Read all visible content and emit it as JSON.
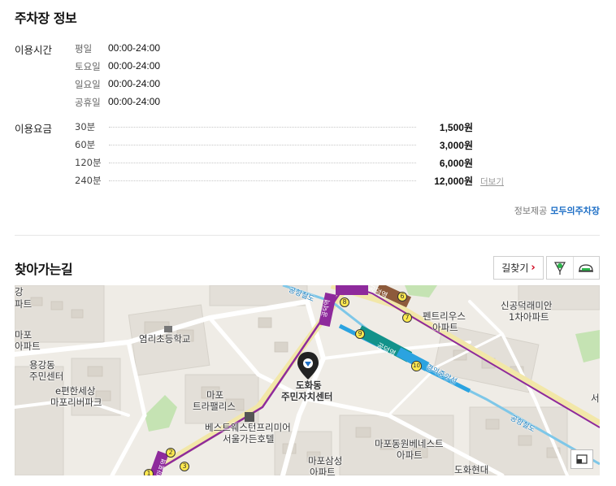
{
  "info": {
    "title": "주차장 정보",
    "hours_label": "이용시간",
    "hours": [
      {
        "day": "평일",
        "time": "00:00-24:00"
      },
      {
        "day": "토요일",
        "time": "00:00-24:00"
      },
      {
        "day": "일요일",
        "time": "00:00-24:00"
      },
      {
        "day": "공휴일",
        "time": "00:00-24:00"
      }
    ],
    "fee_label": "이용요금",
    "fees": [
      {
        "duration": "30분",
        "price": "1,500원"
      },
      {
        "duration": "60분",
        "price": "3,000원"
      },
      {
        "duration": "120분",
        "price": "6,000원"
      },
      {
        "duration": "240분",
        "price": "12,000원"
      }
    ],
    "more_label": "더보기",
    "provider_label": "정보제공",
    "provider_name": "모두의주차장"
  },
  "directions": {
    "title": "찾아가는길",
    "route_button": "길찾기",
    "route_chevron": "›"
  },
  "map": {
    "labels": {
      "gang": "강",
      "apt_left": "파트",
      "mapo_apt_1": "마포",
      "mapo_apt_2": "아파트",
      "yeomni_school": "염리초등학교",
      "yonggang_1": "용강동",
      "yonggang_2": "주민센터",
      "epyeonhan_1": "e편한세상",
      "epyeonhan_2": "마포리버파크",
      "trapalace_1": "마포",
      "trapalace_2": "트라팰리스",
      "best_western_1": "베스트웨스턴프리미어",
      "best_western_2": "서울가든호텔",
      "target_1": "도화동",
      "target_2": "주민자치센터",
      "pentarius_1": "펜트리우스",
      "pentarius_2": "아파트",
      "singong_1": "신공덕래미안",
      "singong_2": "1차아파트",
      "mapo_benest_1": "마포동원베네스트",
      "mapo_benest_2": "아파트",
      "mapo_samsung_1": "마포삼성",
      "mapo_samsung_2": "아파트",
      "dohwa_hyundai": "도화현대",
      "seo": "서",
      "gongdeok_station_top": "공덕역",
      "gongdeok_station_mid": "공덕역",
      "gyeongui_line": "경의중앙선",
      "airport_rail_top": "공항철도",
      "airport_rail_right": "공항철도",
      "gongdeok_vertical": "공덕역",
      "mapo_station": "마포역",
      "exit_1": "1",
      "exit_2": "2",
      "exit_3": "3",
      "exit_6": "6",
      "exit_7": "7",
      "exit_8": "8",
      "exit_9": "9",
      "exit_10": "10",
      "hotel_h": "H"
    }
  },
  "colors": {
    "brand": "#1e6fc6",
    "route_chevron": "#d0021b",
    "line5": "#8e2a9c",
    "line6": "#8d5a3b",
    "airport": "#0e96c8",
    "gyeongui": "#2ba3e0",
    "teal": "#12928a"
  }
}
